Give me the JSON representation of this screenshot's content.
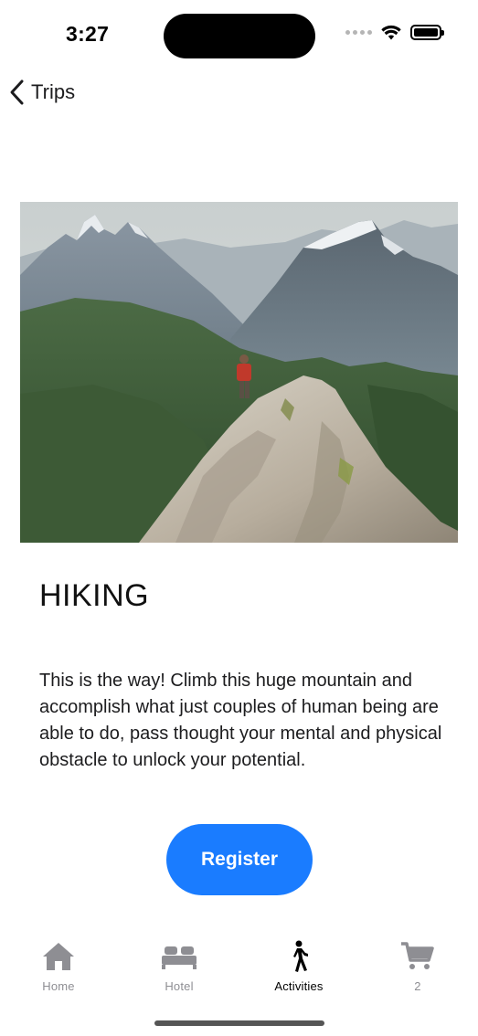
{
  "status_bar": {
    "time": "3:27"
  },
  "nav": {
    "back_label": "Trips"
  },
  "activity": {
    "title": "HIKING",
    "description": "This is the way! Climb this huge mountain and accomplish what just couples of human being are able to do, pass thought your mental and physical obstacle to unlock your potential.",
    "register_label": "Register"
  },
  "tabs": [
    {
      "label": "Home",
      "icon": "house-icon",
      "active": false
    },
    {
      "label": "Hotel",
      "icon": "bed-icon",
      "active": false
    },
    {
      "label": "Activities",
      "icon": "walking-person-icon",
      "active": true
    },
    {
      "label": "2",
      "icon": "cart-icon",
      "active": false
    }
  ],
  "colors": {
    "accent": "#1a7cff",
    "tab_inactive": "#8e8e93",
    "tab_active": "#000000"
  }
}
